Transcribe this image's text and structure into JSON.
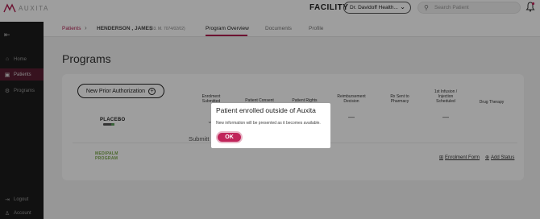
{
  "header": {
    "logo_text": "AUXITA",
    "facility_label": "FACILITY",
    "facility_value": "Dr. Davidoff Health...",
    "search_placeholder": "Search Patient"
  },
  "sidebar": {
    "items": [
      {
        "label": "Home",
        "icon": "home-icon"
      },
      {
        "label": "Patients",
        "icon": "patients-icon",
        "active": true
      },
      {
        "label": "Programs",
        "icon": "programs-icon"
      }
    ],
    "bottom_items": [
      {
        "label": "Logout",
        "icon": "logout-icon"
      },
      {
        "label": "Account",
        "icon": "account-icon"
      }
    ]
  },
  "breadcrumb": {
    "patients": "Patients",
    "patient_name": "HENDERSON , JAMES",
    "patient_dob": "(03. M. 7074/02/02)"
  },
  "tabs": [
    {
      "label": "Program Overview",
      "active": true
    },
    {
      "label": "Documents"
    },
    {
      "label": "Profile"
    }
  ],
  "page": {
    "title": "Programs",
    "new_pa_button": "New Prior Authorization"
  },
  "table": {
    "columns": [
      "Enrolment Submitted",
      "Patient Consent",
      "Patient Rights",
      "Reimbursement Decision",
      "Rx Sent to Pharmacy",
      "1st Infusion / Injection Scheduled",
      "Drug Therapy"
    ],
    "row1": {
      "program": "PLACEBO",
      "reimbursement": "—",
      "infusion": "—"
    },
    "submit_text": "Submitt",
    "row2": {
      "program_line1": "MEDIPALM",
      "program_line2": "PROGRAM"
    },
    "links": {
      "enrolment_form": "Enrolment Form",
      "add_status": "Add Status"
    }
  },
  "modal": {
    "title": "Patient enrolled outside of Auxita",
    "message": "New information will be presented as it becomes available.",
    "ok_label": "OK"
  },
  "colors": {
    "accent": "#c0245a",
    "sidebar_bg": "#1c1c1c",
    "sidebar_active": "#5a1e33"
  }
}
